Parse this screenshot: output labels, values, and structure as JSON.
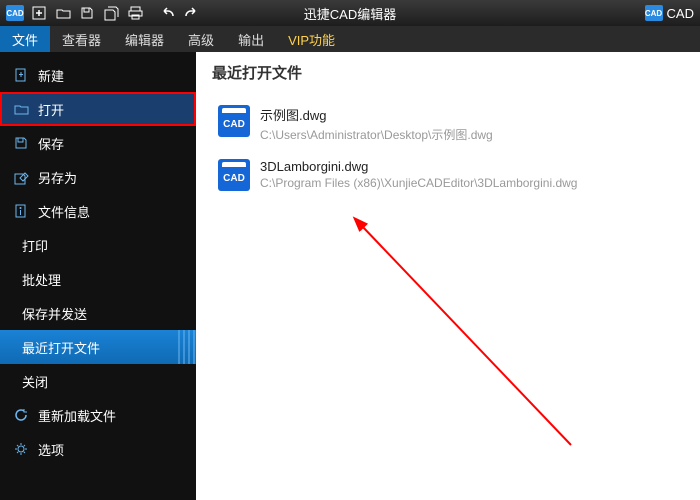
{
  "app": {
    "title": "迅捷CAD编辑器",
    "right_brand": "CAD",
    "brand_mark": "CAD"
  },
  "toolbar_icons": [
    {
      "name": "app-logo-icon"
    },
    {
      "name": "new-file-icon"
    },
    {
      "name": "open-folder-icon"
    },
    {
      "name": "save-icon"
    },
    {
      "name": "save-all-icon"
    },
    {
      "name": "print-icon"
    },
    {
      "name": "undo-icon"
    },
    {
      "name": "redo-icon"
    }
  ],
  "tabs": [
    {
      "label": "文件",
      "name": "tab-file",
      "cls": "active"
    },
    {
      "label": "查看器",
      "name": "tab-viewer",
      "cls": ""
    },
    {
      "label": "编辑器",
      "name": "tab-editor",
      "cls": ""
    },
    {
      "label": "高级",
      "name": "tab-advanced",
      "cls": ""
    },
    {
      "label": "输出",
      "name": "tab-output",
      "cls": ""
    },
    {
      "label": "VIP功能",
      "name": "tab-vip",
      "cls": "vip"
    }
  ],
  "sidebar": [
    {
      "label": "新建",
      "name": "sidebar-new",
      "icon": "new-icon",
      "cls": ""
    },
    {
      "label": "打开",
      "name": "sidebar-open",
      "icon": "open-icon",
      "cls": "hl-red"
    },
    {
      "label": "保存",
      "name": "sidebar-save",
      "icon": "save-icon",
      "cls": ""
    },
    {
      "label": "另存为",
      "name": "sidebar-save-as",
      "icon": "save-as-icon",
      "cls": ""
    },
    {
      "label": "文件信息",
      "name": "sidebar-file-info",
      "icon": "info-icon",
      "cls": ""
    },
    {
      "label": "打印",
      "name": "sidebar-print",
      "icon": "",
      "cls": "no-icon"
    },
    {
      "label": "批处理",
      "name": "sidebar-batch",
      "icon": "",
      "cls": "no-icon"
    },
    {
      "label": "保存并发送",
      "name": "sidebar-save-send",
      "icon": "",
      "cls": "no-icon"
    },
    {
      "label": "最近打开文件",
      "name": "sidebar-recent",
      "icon": "",
      "cls": "no-icon hl-blue"
    },
    {
      "label": "关闭",
      "name": "sidebar-close",
      "icon": "",
      "cls": "no-icon"
    },
    {
      "label": "重新加载文件",
      "name": "sidebar-reload",
      "icon": "reload-icon",
      "cls": ""
    },
    {
      "label": "选项",
      "name": "sidebar-options",
      "icon": "gear-icon",
      "cls": ""
    }
  ],
  "content": {
    "title": "最近打开文件",
    "files": [
      {
        "name": "示例图.dwg",
        "path": "C:\\Users\\Administrator\\Desktop\\示例图.dwg",
        "icon_text": "CAD"
      },
      {
        "name": "3DLamborgini.dwg",
        "path": "C:\\Program Files (x86)\\XunjieCADEditor\\3DLamborgini.dwg",
        "icon_text": "CAD"
      }
    ]
  }
}
